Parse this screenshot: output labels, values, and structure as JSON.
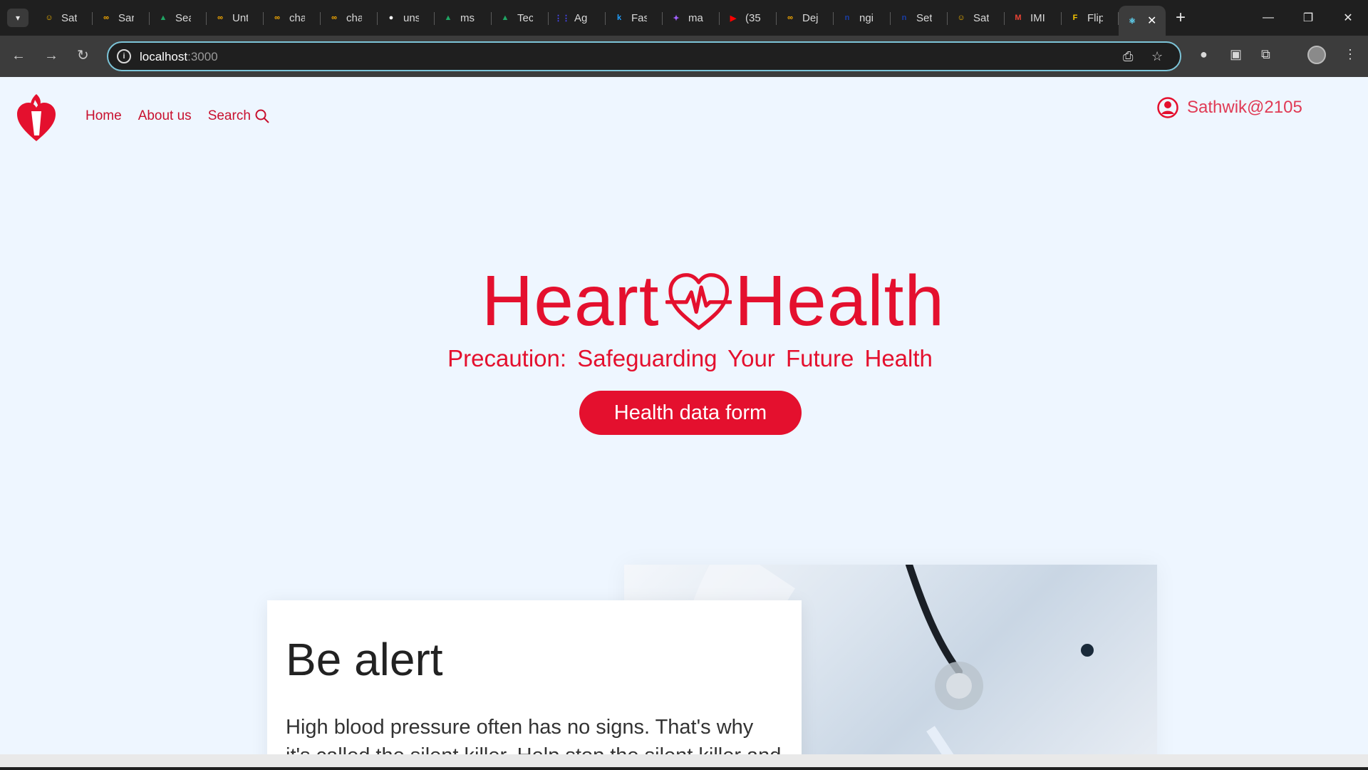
{
  "browser": {
    "tabs": [
      {
        "label": "Sat",
        "icon": "hugging-face-icon",
        "color": "#f2b400"
      },
      {
        "label": "Sar",
        "icon": "colab-icon",
        "color": "#f9ab00"
      },
      {
        "label": "Sea",
        "icon": "google-drive-icon",
        "color": "#1fa463"
      },
      {
        "label": "Unt",
        "icon": "colab-icon",
        "color": "#f9ab00"
      },
      {
        "label": "cha",
        "icon": "colab-icon",
        "color": "#f9ab00"
      },
      {
        "label": "cha",
        "icon": "colab-icon",
        "color": "#f9ab00"
      },
      {
        "label": "uns",
        "icon": "github-icon",
        "color": "#ffffff"
      },
      {
        "label": "ms",
        "icon": "google-drive-icon",
        "color": "#1fa463"
      },
      {
        "label": "Tec",
        "icon": "google-drive-icon",
        "color": "#1fa463"
      },
      {
        "label": "Ag",
        "icon": "grid-icon",
        "color": "#4a4aff"
      },
      {
        "label": "Fas",
        "icon": "k-icon",
        "color": "#20a0ff"
      },
      {
        "label": "ma",
        "icon": "sparkle-icon",
        "color": "#a060ff"
      },
      {
        "label": "(35",
        "icon": "youtube-icon",
        "color": "#ff0000"
      },
      {
        "label": "Dej",
        "icon": "colab-icon",
        "color": "#f9ab00"
      },
      {
        "label": "ngi",
        "icon": "n-icon",
        "color": "#1a3fa8"
      },
      {
        "label": "Set",
        "icon": "n-icon",
        "color": "#1a3fa8"
      },
      {
        "label": "Sat",
        "icon": "hugging-face-icon",
        "color": "#f2b400"
      },
      {
        "label": "IMI",
        "icon": "gmail-icon",
        "color": "#ea4335"
      },
      {
        "label": "Flip",
        "icon": "flipkart-icon",
        "color": "#f7c600"
      }
    ],
    "active_tab_icon": "react-icon",
    "url_host": "localhost",
    "url_port": ":3000"
  },
  "nav": {
    "home": "Home",
    "about": "About us",
    "search": "Search"
  },
  "user": {
    "name": "Sathwik@2105"
  },
  "hero": {
    "title_left": "Heart",
    "title_right": "Health",
    "subtitle": "Precaution: Safeguarding Your Future Health",
    "cta": "Health data form"
  },
  "card": {
    "title": "Be alert",
    "body": "High blood pressure often has no signs. That's why it's called the silent killer. Help stop the silent killer and"
  },
  "colors": {
    "brand_red": "#e4102e",
    "page_bg": "#eef6ff"
  }
}
